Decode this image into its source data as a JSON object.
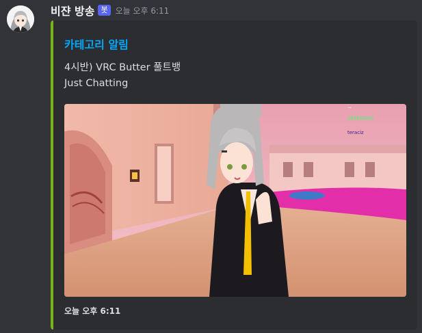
{
  "message": {
    "username": "비쟌 방송",
    "bot_tag": "봇",
    "timestamp": "오늘 오후 6:11"
  },
  "embed": {
    "accent_color": "#7ab317",
    "title": "카테고리 알림",
    "description_line1": "4시반) VRC Butter 풀트뱅",
    "description_line2": "Just Chatting",
    "footer": "오늘 오후 6:11",
    "image_overlay": {
      "top_text": "~",
      "green_text": "283830202",
      "chat_name": "teraciz"
    }
  }
}
